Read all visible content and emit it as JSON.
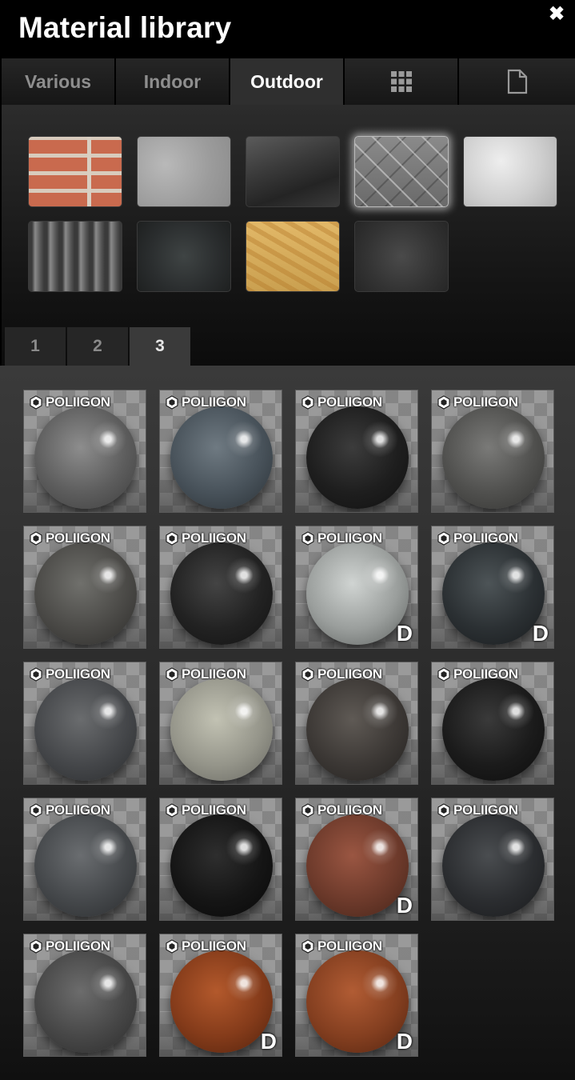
{
  "window": {
    "title": "Material library"
  },
  "tabs": [
    {
      "label": "Various",
      "active": false
    },
    {
      "label": "Indoor",
      "active": false
    },
    {
      "label": "Outdoor",
      "active": true
    },
    {
      "label": "",
      "icon": "grid-icon",
      "active": false
    },
    {
      "label": "",
      "icon": "document-icon",
      "active": false
    }
  ],
  "categories": [
    {
      "name": "brick-swatch",
      "selected": false
    },
    {
      "name": "concrete-swatch",
      "selected": false
    },
    {
      "name": "glass-swatch",
      "selected": false
    },
    {
      "name": "metal-tread-plate-swatch",
      "selected": true
    },
    {
      "name": "plaster-swatch",
      "selected": false
    },
    {
      "name": "roof-tiles-swatch",
      "selected": false
    },
    {
      "name": "granite-swatch",
      "selected": false
    },
    {
      "name": "osb-wood-swatch",
      "selected": false
    },
    {
      "name": "asphalt-swatch",
      "selected": false
    }
  ],
  "pages": [
    {
      "label": "1",
      "active": false
    },
    {
      "label": "2",
      "active": false
    },
    {
      "label": "3",
      "active": true
    }
  ],
  "brand": "POLIIGON",
  "materials": [
    {
      "badge": ""
    },
    {
      "badge": ""
    },
    {
      "badge": ""
    },
    {
      "badge": ""
    },
    {
      "badge": ""
    },
    {
      "badge": ""
    },
    {
      "badge": "D"
    },
    {
      "badge": "D"
    },
    {
      "badge": ""
    },
    {
      "badge": ""
    },
    {
      "badge": ""
    },
    {
      "badge": ""
    },
    {
      "badge": ""
    },
    {
      "badge": ""
    },
    {
      "badge": "D"
    },
    {
      "badge": ""
    },
    {
      "badge": ""
    },
    {
      "badge": "D"
    },
    {
      "badge": "D"
    }
  ]
}
